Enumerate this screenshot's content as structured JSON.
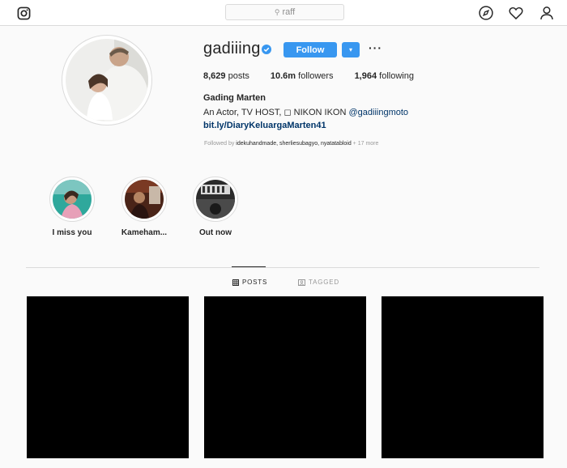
{
  "nav": {
    "search_placeholder": "raff",
    "icons": [
      "instagram-icon",
      "search-icon",
      "compass-icon",
      "heart-icon",
      "user-icon"
    ]
  },
  "profile": {
    "username": "gadiiing",
    "follow_label": "Follow",
    "dropdown_label": "▾",
    "more_label": "···",
    "stats": {
      "posts_count": "8,629",
      "posts_label": "posts",
      "followers_count": "10.6m",
      "followers_label": "followers",
      "following_count": "1,964",
      "following_label": "following"
    },
    "full_name": "Gading Marten",
    "bio_text": "An Actor, TV HOST, ◻ NIKON IKON ",
    "bio_mention": "@gadiiingmoto",
    "bio_link": "bit.ly/DiaryKeluargaMarten41",
    "followed_by_prefix": "Followed by ",
    "followed_by_names": "idekuhandmade, sherliesubagyo, nyatatabloid",
    "followed_by_more": " + 17 more"
  },
  "highlights": [
    {
      "label": "I miss you"
    },
    {
      "label": "Kameham..."
    },
    {
      "label": "Out now"
    }
  ],
  "tabs": {
    "posts_label": "POSTS",
    "tagged_label": "TAGGED"
  },
  "colors": {
    "accent": "#3897f0",
    "link": "#003569",
    "border": "#dbdbdb",
    "background": "#fafafa"
  }
}
